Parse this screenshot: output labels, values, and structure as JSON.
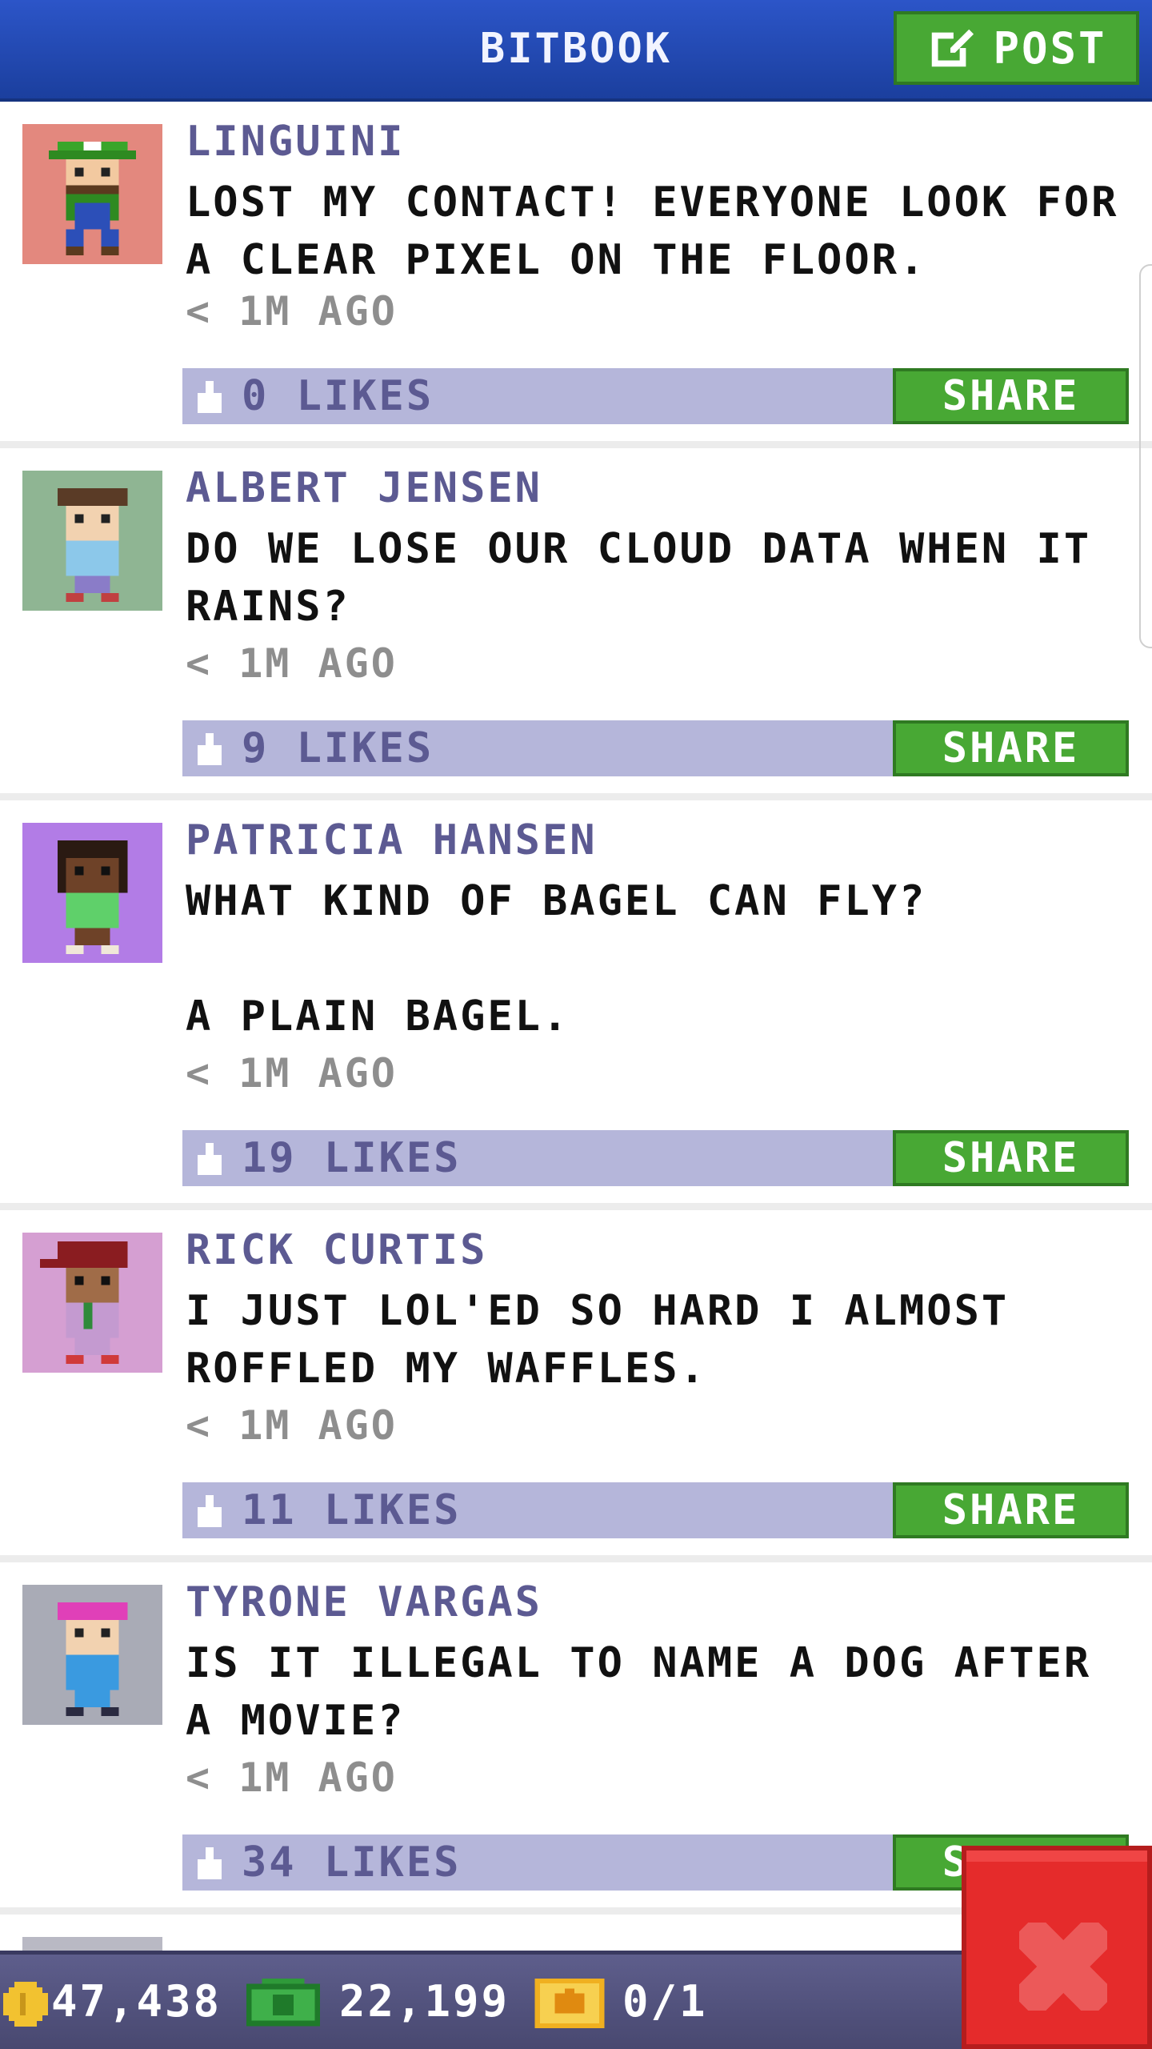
{
  "app": {
    "title": "BITBOOK",
    "post_label": "POST"
  },
  "posts": [
    {
      "author": "LINGUINI",
      "message": "LOST MY CONTACT! EVERYONE LOOK FOR A CLEAR PIXEL ON THE FLOOR.",
      "time": "< 1M AGO",
      "likes": "0 LIKES",
      "share_label": "SHARE",
      "avatar_bg": "#e3887e"
    },
    {
      "author": "ALBERT JENSEN",
      "message": "DO WE LOSE OUR CLOUD DATA WHEN IT RAINS?",
      "time": "< 1M AGO",
      "likes": "9 LIKES",
      "share_label": "SHARE",
      "avatar_bg": "#8fb593"
    },
    {
      "author": "PATRICIA HANSEN",
      "message": "WHAT KIND OF BAGEL CAN FLY?\n\nA PLAIN BAGEL.",
      "time": "< 1M AGO",
      "likes": "19 LIKES",
      "share_label": "SHARE",
      "avatar_bg": "#b27ce6"
    },
    {
      "author": "RICK CURTIS",
      "message": "I JUST LOL'ED SO HARD I ALMOST ROFFLED MY WAFFLES.",
      "time": "< 1M AGO",
      "likes": "11 LIKES",
      "share_label": "SHARE",
      "avatar_bg": "#d59fd2"
    },
    {
      "author": "TYRONE VARGAS",
      "message": "IS IT ILLEGAL TO NAME A DOG AFTER A MOVIE?",
      "time": "< 1M AGO",
      "likes": "34 LIKES",
      "share_label": "SHARE",
      "avatar_bg": "#a9abb6"
    }
  ],
  "status_bar": {
    "coins": "47,438",
    "bux": "22,199",
    "tickets": "0/1"
  },
  "colors": {
    "header": "#2447b5",
    "accent_green": "#48a834",
    "like_bar": "#b5b6da",
    "name_text": "#5c5a92",
    "close_red": "#e52b2b",
    "bottom_bar": "#55557f"
  },
  "icons": {
    "post": "edit-icon",
    "like": "thumbs-up-icon",
    "coin": "coin-icon",
    "bux": "bitbux-icon",
    "ticket": "vip-ticket-icon",
    "close": "close-icon"
  }
}
